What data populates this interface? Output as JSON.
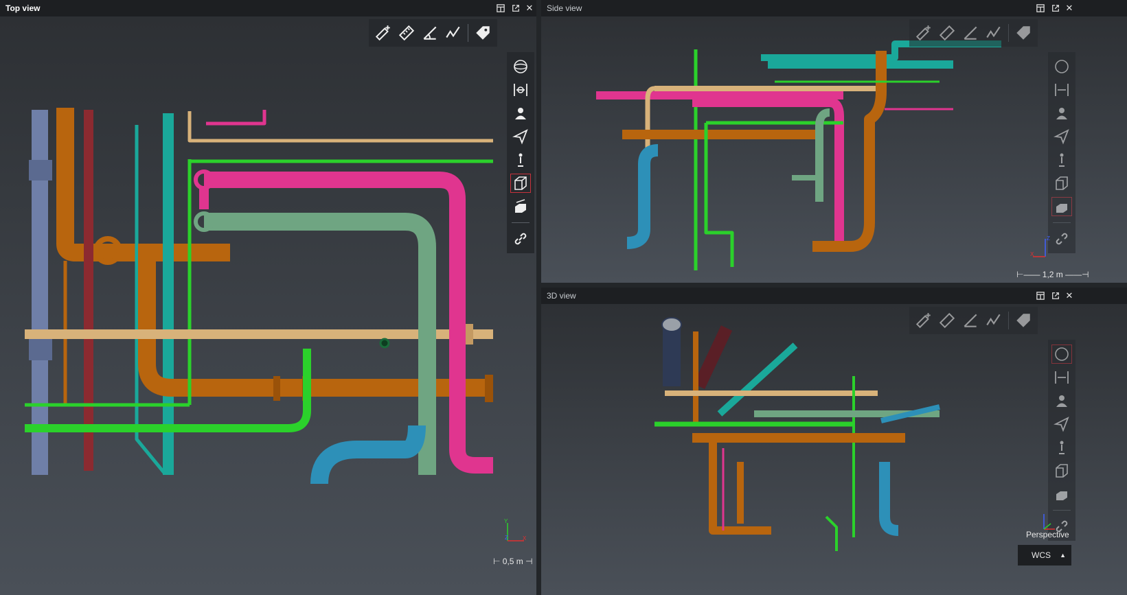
{
  "panels": {
    "top": {
      "title": "Top view",
      "scale": "⊢ 0,5 m ⊣"
    },
    "side": {
      "title": "Side view",
      "scale": "⊢—— 1,2 m ——⊣"
    },
    "three_d": {
      "title": "3D view",
      "projection": "Perspective",
      "coord_system": "WCS",
      "coord_arrow": "▲"
    }
  },
  "window_controls": {
    "layout": "layout-icon",
    "popout": "popout-icon",
    "close": "✕"
  },
  "toolbar_tools": [
    "add-measure-icon",
    "measure-icon",
    "angle-measure-icon",
    "path-measure-icon",
    "tag-icon"
  ],
  "view_tools": [
    "orbit-icon",
    "fit-icon",
    "walk-person-icon",
    "fly-icon",
    "stand-person-icon",
    "box-view-icon",
    "section-icon",
    "link-icon"
  ],
  "axis_labels": {
    "x": "X",
    "y": "Y",
    "z": "Z"
  },
  "colors": {
    "pink": "#e0358f",
    "orange": "#b8650e",
    "green": "#2bd12b",
    "teal": "#1aa89a",
    "sage": "#6fa582",
    "tan": "#d8b27a",
    "blue": "#2d90b8",
    "steel": "#6f7fa8",
    "maroon": "#8c2a30",
    "active_outline": "#c8323c"
  }
}
